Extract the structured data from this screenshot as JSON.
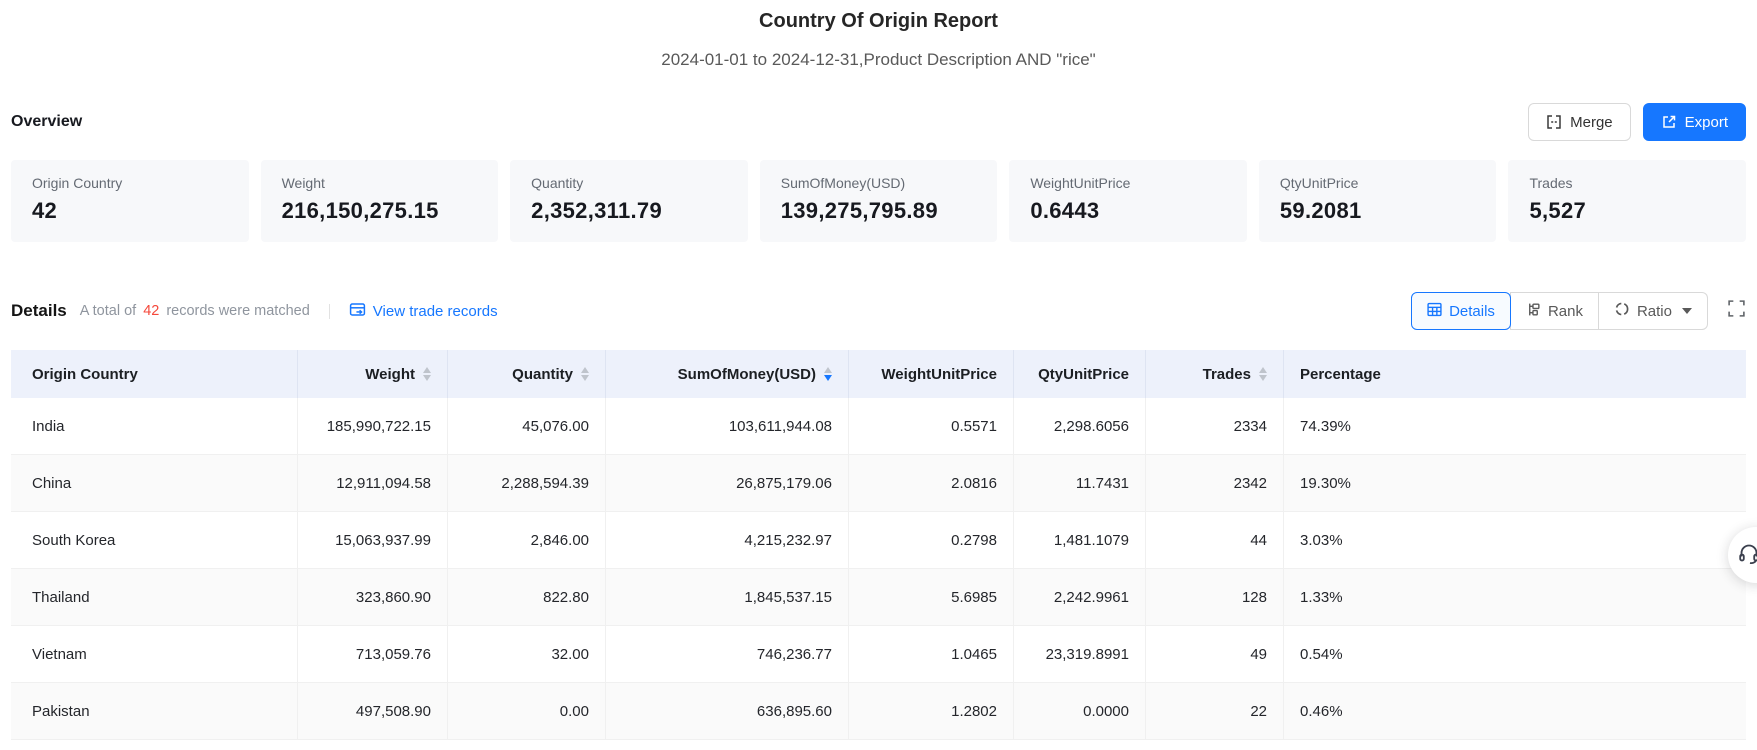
{
  "page": {
    "title": "Country Of Origin Report",
    "subtitle": "2024-01-01 to 2024-12-31,Product Description AND \"rice\""
  },
  "overview": {
    "section_title": "Overview",
    "merge_label": "Merge",
    "export_label": "Export",
    "cards": [
      {
        "label": "Origin Country",
        "value": "42"
      },
      {
        "label": "Weight",
        "value": "216,150,275.15"
      },
      {
        "label": "Quantity",
        "value": "2,352,311.79"
      },
      {
        "label": "SumOfMoney(USD)",
        "value": "139,275,795.89"
      },
      {
        "label": "WeightUnitPrice",
        "value": "0.6443"
      },
      {
        "label": "QtyUnitPrice",
        "value": "59.2081"
      },
      {
        "label": "Trades",
        "value": "5,527"
      }
    ]
  },
  "details": {
    "section_title": "Details",
    "matched_prefix": "A total of",
    "matched_count": "42",
    "matched_suffix": "records were matched",
    "view_trade_records_label": "View trade records",
    "view_modes": {
      "details": "Details",
      "rank": "Rank",
      "ratio": "Ratio"
    },
    "sorted_column": "SumOfMoney(USD)",
    "sort_direction": "descending"
  },
  "table": {
    "columns": [
      {
        "label": "Origin Country"
      },
      {
        "label": "Weight"
      },
      {
        "label": "Quantity"
      },
      {
        "label": "SumOfMoney(USD)"
      },
      {
        "label": "WeightUnitPrice"
      },
      {
        "label": "QtyUnitPrice"
      },
      {
        "label": "Trades"
      },
      {
        "label": "Percentage"
      }
    ],
    "rows": [
      {
        "cells": [
          "India",
          "185,990,722.15",
          "45,076.00",
          "103,611,944.08",
          "0.5571",
          "2,298.6056",
          "2334",
          "74.39%"
        ]
      },
      {
        "cells": [
          "China",
          "12,911,094.58",
          "2,288,594.39",
          "26,875,179.06",
          "2.0816",
          "11.7431",
          "2342",
          "19.30%"
        ]
      },
      {
        "cells": [
          "South Korea",
          "15,063,937.99",
          "2,846.00",
          "4,215,232.97",
          "0.2798",
          "1,481.1079",
          "44",
          "3.03%"
        ]
      },
      {
        "cells": [
          "Thailand",
          "323,860.90",
          "822.80",
          "1,845,537.15",
          "5.6985",
          "2,242.9961",
          "128",
          "1.33%"
        ]
      },
      {
        "cells": [
          "Vietnam",
          "713,059.76",
          "32.00",
          "746,236.77",
          "1.0465",
          "23,319.8991",
          "49",
          "0.54%"
        ]
      },
      {
        "cells": [
          "Pakistan",
          "497,508.90",
          "0.00",
          "636,895.60",
          "1.2802",
          "0.0000",
          "22",
          "0.46%"
        ]
      }
    ]
  },
  "colors": {
    "accent_blue": "#1677ff",
    "count_red": "#f5483b",
    "table_header_bg": "#edf1fb",
    "card_bg": "#f7f8fa"
  }
}
